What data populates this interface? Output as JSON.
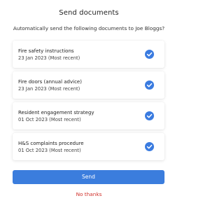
{
  "dialog": {
    "title": "Send documents",
    "subtitle": "Automatically send the following documents to Joe Bloggs?",
    "documents": [
      {
        "name": "Fire safety instructions",
        "date": "23 Jan 2023 (Most recent)",
        "checked": true
      },
      {
        "name": "Fire doors (annual advice)",
        "date": "23 Jan 2023 (Most recent)",
        "checked": true
      },
      {
        "name": "Resident engagement strategy",
        "date": "01 Oct 2023 (Most recent)",
        "checked": true
      },
      {
        "name": "H&S complaints procedure",
        "date": "01 Oct 2023 (Most recent)",
        "checked": true
      }
    ],
    "send_label": "Send",
    "decline_label": "No thanks"
  },
  "colors": {
    "accent": "#3b7ddd",
    "decline": "#d0302a",
    "check": "#3a7be0"
  },
  "icons": {
    "document_status": "check-circle-icon"
  }
}
